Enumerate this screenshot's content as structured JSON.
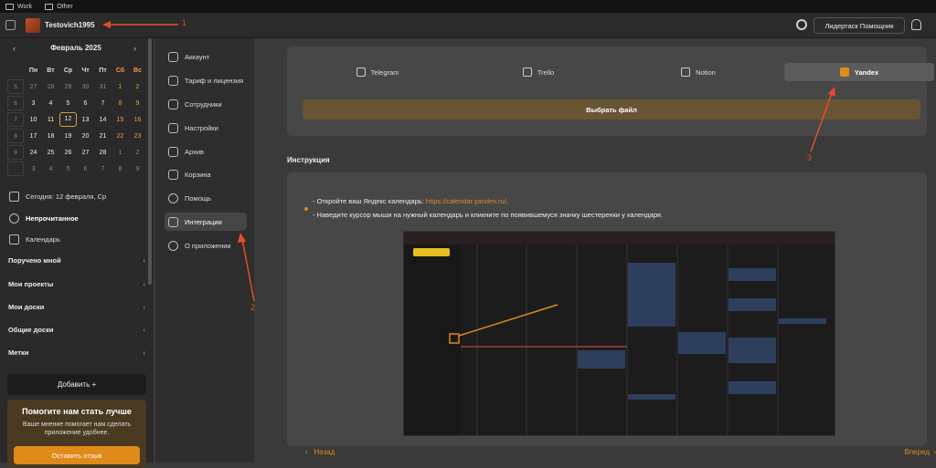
{
  "bookmarks": [
    {
      "label": "Work"
    },
    {
      "label": "Other"
    }
  ],
  "topbar": {
    "username": "Testovich1995",
    "assistant_label": "Лидертаск Помощник"
  },
  "calendar": {
    "month_title": "Февраль 2025",
    "weekdays": [
      "Пн",
      "Вт",
      "Ср",
      "Чт",
      "Пт",
      "Сб",
      "Вс"
    ],
    "weeks": [
      {
        "num": "5",
        "days": [
          "27",
          "28",
          "29",
          "30",
          "31",
          "1",
          "2"
        ]
      },
      {
        "num": "6",
        "days": [
          "3",
          "4",
          "5",
          "6",
          "7",
          "8",
          "9"
        ]
      },
      {
        "num": "7",
        "days": [
          "10",
          "11",
          "12",
          "13",
          "14",
          "15",
          "16"
        ]
      },
      {
        "num": "8",
        "days": [
          "17",
          "18",
          "19",
          "20",
          "21",
          "22",
          "23"
        ]
      },
      {
        "num": "9",
        "days": [
          "24",
          "25",
          "26",
          "27",
          "28",
          "1",
          "2"
        ]
      },
      {
        "num": "",
        "days": [
          "3",
          "4",
          "5",
          "6",
          "7",
          "8",
          "9"
        ]
      }
    ]
  },
  "sidebar": {
    "today": "Сегодня: 12 февраля, Ср",
    "unread": "Непрочитанное",
    "calendar": "Календарь",
    "sections": [
      "Поручено мной",
      "Мои проекты",
      "Мои доски",
      "Общие доски",
      "Метки"
    ],
    "add_label": "Добавить +",
    "promo_title": "Помогите нам стать лучше",
    "promo_text": "Ваше мнение помогает нам сделать приложение удобнее.",
    "promo_button": "Оставить отзыв"
  },
  "settings_menu": [
    "Аккаунт",
    "Тариф и лицензия",
    "Сотрудники",
    "Настройки",
    "Архив",
    "Корзина",
    "Помощь",
    "Интеграции",
    "О приложении"
  ],
  "integrations": {
    "tabs": [
      "Telegram",
      "Trello",
      "Notion",
      "Yandex"
    ],
    "file_button": "Выбрать файл",
    "instruction_label": "Инструкция",
    "line1_prefix": "- Откройте ваш Яндекс календарь: ",
    "line1_link": "https://calendar.yandex.ru/",
    "line1_suffix": ".",
    "line2": "- Наведите курсор мыши на нужный календарь и кликните по появившемуся значку шестеренки у календаря.",
    "prev": "Назад",
    "next": "Вперед"
  },
  "annotations": [
    "1",
    "2",
    "3"
  ],
  "colors": {
    "accent": "#e08a1a",
    "annotation": "#e74c2a"
  }
}
